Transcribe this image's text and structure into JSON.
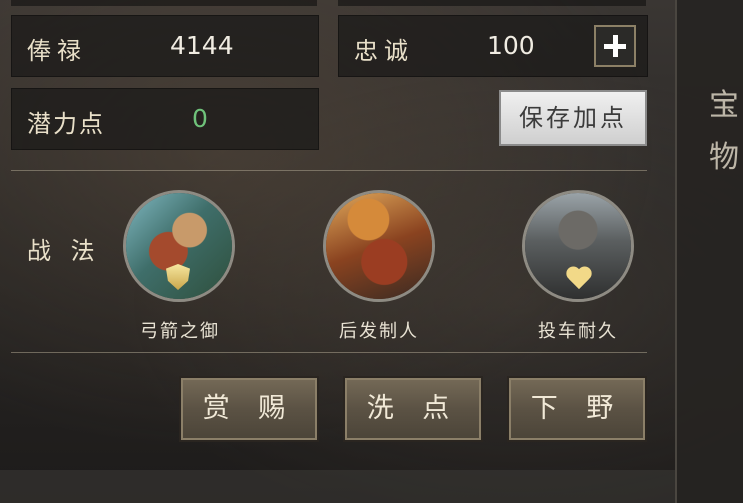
{
  "stats": {
    "salary": {
      "label": "俸禄",
      "value": "4144"
    },
    "loyalty": {
      "label": "忠诚",
      "value": "100"
    },
    "potential": {
      "label": "潜力点",
      "value": "0"
    }
  },
  "buttons": {
    "save_points": "保存加点",
    "reward": "赏 赐",
    "reset_points": "洗 点",
    "dismiss": "下 野"
  },
  "tactics": {
    "label": "战 法",
    "skills": [
      {
        "name": "弓箭之御",
        "emblem": "shield-icon"
      },
      {
        "name": "后发制人",
        "emblem": "none"
      },
      {
        "name": "投车耐久",
        "emblem": "heart-icon"
      }
    ]
  },
  "side_panel": {
    "chars": [
      "宝",
      "物"
    ]
  },
  "colors": {
    "potential_value": "#6fc27a",
    "label_gold": "#e9e0c9",
    "button_brown": "#5b5244"
  }
}
